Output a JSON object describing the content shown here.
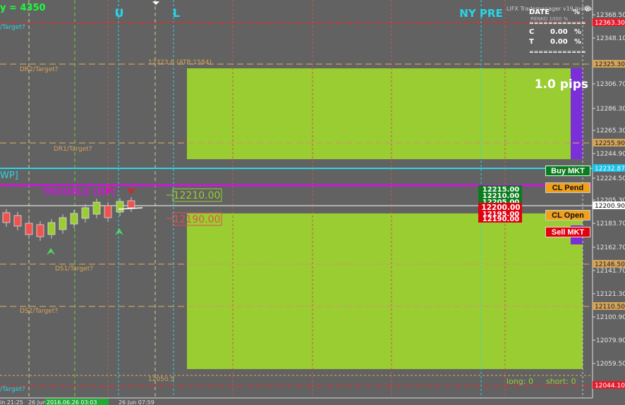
{
  "top_left_label": "y = 4350",
  "top_letters": {
    "u": "U",
    "l": "L",
    "ny": "NY PRE"
  },
  "window_title": "LIFX Trademanager v19 Indicat",
  "close_glyph": "⊗",
  "stats": {
    "date_label": "DATE",
    "date_unit": "%",
    "sub": "RENKO 1000 %",
    "sep": "============",
    "rows": [
      {
        "label": "C",
        "value": "0.00",
        "unit": "%"
      },
      {
        "label": "T",
        "value": "0.00",
        "unit": "%"
      }
    ]
  },
  "pips_label": "1.0 pips",
  "atr_label": "12323.8  (ATR:1584)",
  "bottom_level_label": "12050.5",
  "level_labels": {
    "top_target": "/Target?",
    "dr2": "DR2/Target?",
    "dr1": "DR1/Target?",
    "wp": "WP]",
    "trouble": "TROUBLE (DP)",
    "ds1": "DS1/Target?",
    "ds2": "DS2/Target?",
    "bottom_target": "/Target?"
  },
  "order_boxes": {
    "upper": "12210.00",
    "lower": "12190.00"
  },
  "price_stack": {
    "green": [
      "12215.00",
      "12210.00",
      "12205.00"
    ],
    "current": "12200.00",
    "red": [
      "12195.00",
      "12190.00"
    ]
  },
  "buttons": {
    "buy": "Buy MKT",
    "cl_pend": "CL Pend",
    "cl_open": "CL Open",
    "sell": "Sell MKT"
  },
  "long_short": {
    "long": "long: 0",
    "short": "short: 0"
  },
  "price_axis": {
    "ticks": [
      "12368.50",
      "12348.10",
      "12306.70",
      "12286.30",
      "12265.30",
      "12244.90",
      "12224.50",
      "12205.30",
      "12183.70",
      "12162.70",
      "12141.70",
      "12121.30",
      "12100.90",
      "12079.90",
      "12059.50"
    ],
    "highlights": [
      {
        "value": "12363.30",
        "bg": "#e41b2a",
        "fg": "#ffffff"
      },
      {
        "value": "12325.30",
        "bg": "#d4a35a",
        "fg": "#222222"
      },
      {
        "value": "12255.90",
        "bg": "#d4a35a",
        "fg": "#222222"
      },
      {
        "value": "12232.87",
        "bg": "#19bfe5",
        "fg": "#ffffff"
      },
      {
        "value": "12200.90",
        "bg": "#ffffff",
        "fg": "#111111"
      },
      {
        "value": "12146.50",
        "bg": "#d4a35a",
        "fg": "#222222"
      },
      {
        "value": "12110.50",
        "bg": "#d4a35a",
        "fg": "#222222"
      },
      {
        "value": "12044.10",
        "bg": "#e41b2a",
        "fg": "#ffffff"
      }
    ]
  },
  "time_axis": {
    "labels": [
      "in 21:25",
      "26 Jun",
      "26 Jun 07:59"
    ],
    "highlight": "2016.06.26 03:03"
  },
  "colors": {
    "background": "#626262",
    "box_green": "#9acd32",
    "magenta": "#c71bd6",
    "cyan": "#29d5e8",
    "purple": "#7a2fd9",
    "red_dash": "#d83131",
    "tan_dash": "#c8a060",
    "bull_candle": "#9acd32",
    "bear_candle": "#ef5350"
  },
  "candles": [
    {
      "dir": "bear"
    },
    {
      "dir": "bear"
    },
    {
      "dir": "bear"
    },
    {
      "dir": "bear"
    },
    {
      "dir": "bear"
    },
    {
      "dir": "bear"
    },
    {
      "dir": "bull"
    },
    {
      "dir": "bull"
    },
    {
      "dir": "bull"
    },
    {
      "dir": "bull"
    },
    {
      "dir": "bull"
    },
    {
      "dir": "bull"
    },
    {
      "dir": "bull"
    },
    {
      "dir": "bear"
    },
    {
      "dir": "bull"
    },
    {
      "dir": "bear"
    }
  ]
}
